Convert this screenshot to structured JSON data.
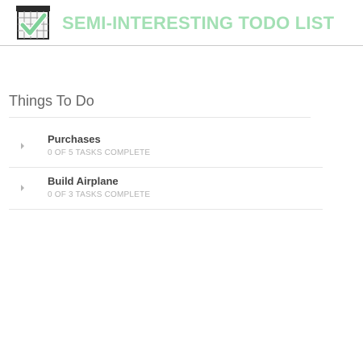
{
  "header": {
    "logo_icon": "checklist-calendar-icon",
    "title": "SEMI-INTERESTING TODO LIST",
    "title_color": "#a3e0b4"
  },
  "main": {
    "section_title": "Things To Do",
    "lists": [
      {
        "name": "Purchases",
        "status": "0 OF 5 TASKS COMPLETE",
        "expand_icon": "caret-right-icon"
      },
      {
        "name": "Build Airplane",
        "status": "0 OF 3 TASKS COMPLETE",
        "expand_icon": "caret-right-icon"
      }
    ]
  }
}
